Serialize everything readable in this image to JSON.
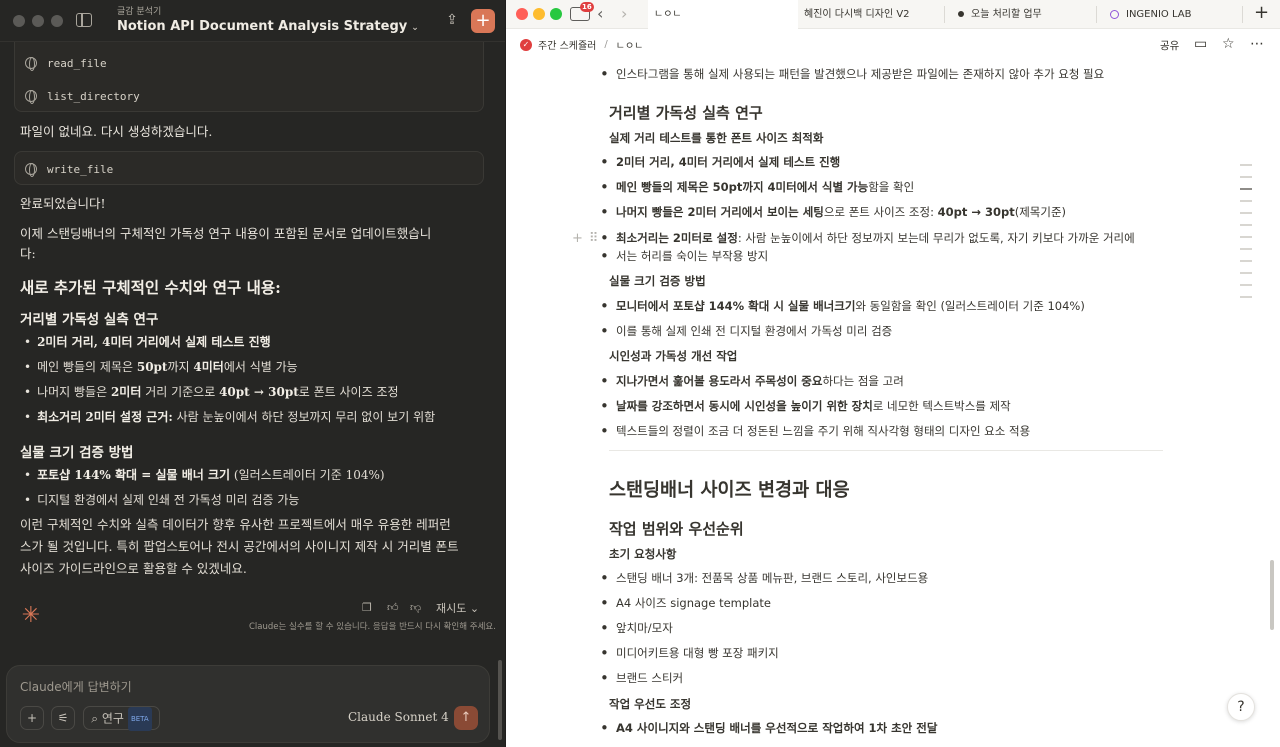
{
  "claude": {
    "breadcrumb": "글감 분석기",
    "title": "Notion API Document Analysis Strategy",
    "tools": [
      "read_file",
      "list_directory",
      "write_file"
    ],
    "msg_missing": "파일이 없네요. 다시 생성하겠습니다.",
    "msg_done": "완료되었습니다!",
    "msg_updated_1": "이제 스탠딩배너의 구체적인 가독성 연구 내용이 포함된 문서로 업데이트했습니",
    "msg_updated_2": "다:",
    "h_new": "새로 추가된 구체적인 수치와 연구 내용:",
    "h_distance": "거리별 가독성 실측 연구",
    "dist_items": [
      {
        "b": "2미터 거리, 4미터 거리에서 실제 테스트 진행",
        "t": ""
      },
      {
        "b": "",
        "t": "메인 빵들의 제목은 ",
        "b2": "50pt",
        "t2": "까지 ",
        "b3": "4미터",
        "t3": "에서 식별 가능"
      },
      {
        "b": "",
        "t": "나머지 빵들은 ",
        "b2": "2미터",
        "t2": " 거리 기준으로 ",
        "b3": "40pt → 30pt",
        "t3": "로 폰트 사이즈 조정"
      },
      {
        "b": "최소거리 2미터 설정 근거:",
        "t": " 사람 눈높이에서 하단 정보까지 무리 없이 보기 위함"
      }
    ],
    "h_size": "실물 크기 검증 방법",
    "size_items": [
      {
        "b": "포토샵 144% 확대 = 실물 배너 크기",
        "t": " (일러스트레이터 기준 104%)"
      },
      {
        "b": "",
        "t": "디지털 환경에서 실제 인쇄 전 가독성 미리 검증 가능"
      }
    ],
    "closing": "이런 구체적인 수치와 실측 데이터가 향후 유사한 프로젝트에서 매우 유용한 레퍼런스가 될 것입니다. 특히 팝업스토어나 전시 공간에서의 사이니지 제작 시 거리별 폰트 사이즈 가이드라인으로 활용할 수 있겠네요.",
    "retry": "재시도",
    "disclaimer": "Claude는 실수를 할 수 있습니다. 응답을 반드시 다시 확인해 주세요.",
    "input_placeholder": "Claude에게 답변하기",
    "research_label": "연구",
    "beta": "BETA",
    "model": "Claude Sonnet 4",
    "accent": "#d97757"
  },
  "notion": {
    "badge_count": "16",
    "tabs": [
      "ㄴㅇㄴ",
      "혜진이 다시백 디자인 V2",
      "오늘 처리할 업무",
      "INGENIO LAB"
    ],
    "crumb_workspace": "주간 스케쥴러",
    "crumb_page": "ㄴㅇㄴ",
    "share": "공유",
    "top_item": "인스타그램을 통해 실제 사용되는 패턴을 발견했으나 제공받은 파일에는 존재하지 않아 추가 요청 필요",
    "h_distance": "거리별 가독성 실측 연구",
    "sub_font": "실제 거리 테스트를 통한 폰트 사이즈 최적화",
    "font_items": [
      {
        "b": "2미터 거리, 4미터 거리에서 실제 테스트 진행",
        "t": ""
      },
      {
        "b": "메인 빵들의 제목은 50pt까지 4미터에서 식별 가능",
        "t": "함을 확인"
      },
      {
        "b": "나머지 빵들은 2미터 거리에서 보이는 세팅",
        "t": "으로 폰트 사이즈 조정: ",
        "b2": "40pt → 30pt",
        "t2": "(제목기준)"
      },
      {
        "b": "최소거리는 2미터로 설정",
        "t": ": 사람 눈높이에서 하단 정보까지 보는데 무리가 없도록, 자기 키보다 가까운 거리에"
      }
    ],
    "font_items_wrap": "서는 허리를 숙이는 부작용 방지",
    "sub_size": "실물 크기 검증 방법",
    "size_items": [
      {
        "b": "모니터에서 포토샵 144% 확대 시 실물 배너크기",
        "t": "와 동일함을 확인 (일러스트레이터 기준 104%)"
      },
      {
        "b": "",
        "t": "이를 통해 실제 인쇄 전 디지털 환경에서 가독성 미리 검증"
      }
    ],
    "sub_visibility": "시인성과 가독성 개선 작업",
    "visibility_items": [
      {
        "b": "지나가면서 훑어볼 용도라서 주목성이 중요",
        "t": "하다는 점을 고려"
      },
      {
        "b": "날짜를 강조하면서 동시에 시인성을 높이기 위한 장치",
        "t": "로 네모한 텍스트박스를 제작"
      },
      {
        "b": "",
        "t": "텍스트들의 정렬이 조금 더 정돈된 느낌을 주기 위해 직사각형 형태의 디자인 요소 적용"
      }
    ],
    "h_banner": "스탠딩배너 사이즈 변경과 대응",
    "h_scope": "작업 범위와 우선순위",
    "sub_initial": "초기 요청사항",
    "initial_items": [
      "스탠딩 배너 3개: 전품목 상품 메뉴판, 브랜드 스토리, 사인보드용",
      "A4 사이즈 signage template",
      "앞치마/모자",
      "미디어키트용 대형 빵 포장 패키지",
      "브랜드 스티커"
    ],
    "sub_priority": "작업 우선도 조정",
    "priority_item": "A4 사이니지와 스탠딩 배너를 우선적으로 작업하여 1차 초안 전달"
  }
}
